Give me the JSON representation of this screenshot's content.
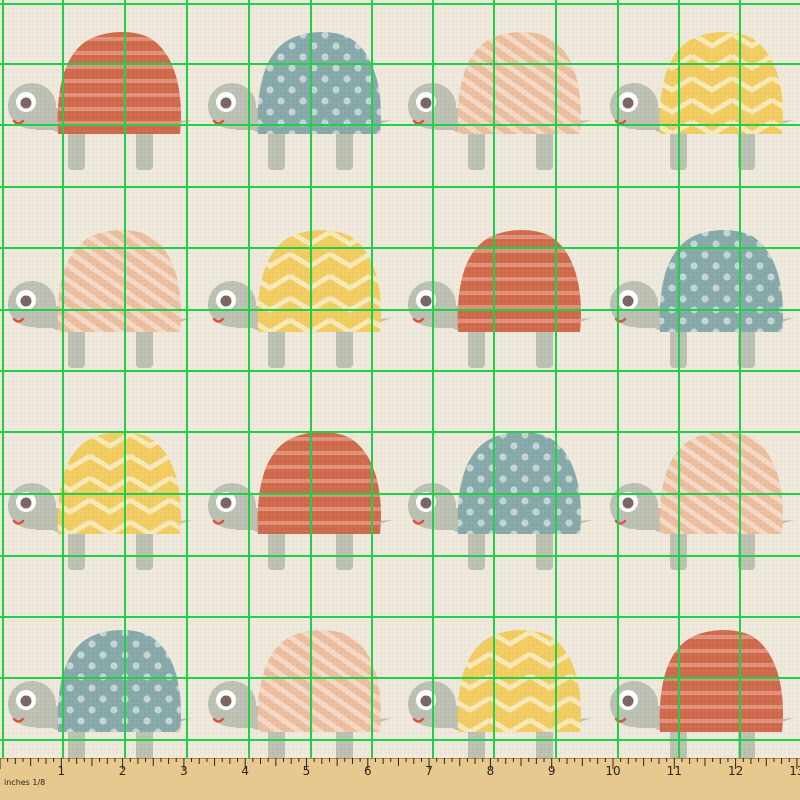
{
  "ruler": {
    "unit_label": "inches 1/8",
    "tick_labels": [
      "1",
      "2",
      "3",
      "4",
      "5",
      "6",
      "7",
      "8",
      "9",
      "10",
      "11",
      "12",
      "13"
    ]
  },
  "palette": {
    "background": "#efe9dc",
    "grid_line": "#1fd146",
    "turtle_body": "#bcc1b3",
    "eye_ring": "#ffffff",
    "eye_pupil": "#7c6563",
    "mouth": "#e0503a",
    "ruler_wood": "#e7c98f",
    "ruler_edge": "#b08a4e",
    "shell_red": "#cf6a4c",
    "shell_red_stripe": "#e3907a",
    "shell_blue": "#87a9a9",
    "shell_blue_dot": "#c5d6d2",
    "shell_peach": "#ebbf9f",
    "shell_peach_stripe": "#f5d9c5",
    "shell_yellow": "#f3cd62",
    "shell_yellow_chevron": "#f8e9b8"
  },
  "pattern": {
    "shells": [
      [
        "red-stripes",
        "blue-dots",
        "peach-diagonal",
        "yellow-chevron"
      ],
      [
        "peach-diagonal",
        "yellow-chevron",
        "red-stripes",
        "blue-dots"
      ],
      [
        "yellow-chevron",
        "red-stripes",
        "blue-dots",
        "peach-diagonal"
      ],
      [
        "blue-dots",
        "peach-diagonal",
        "yellow-chevron",
        "red-stripes"
      ]
    ]
  }
}
